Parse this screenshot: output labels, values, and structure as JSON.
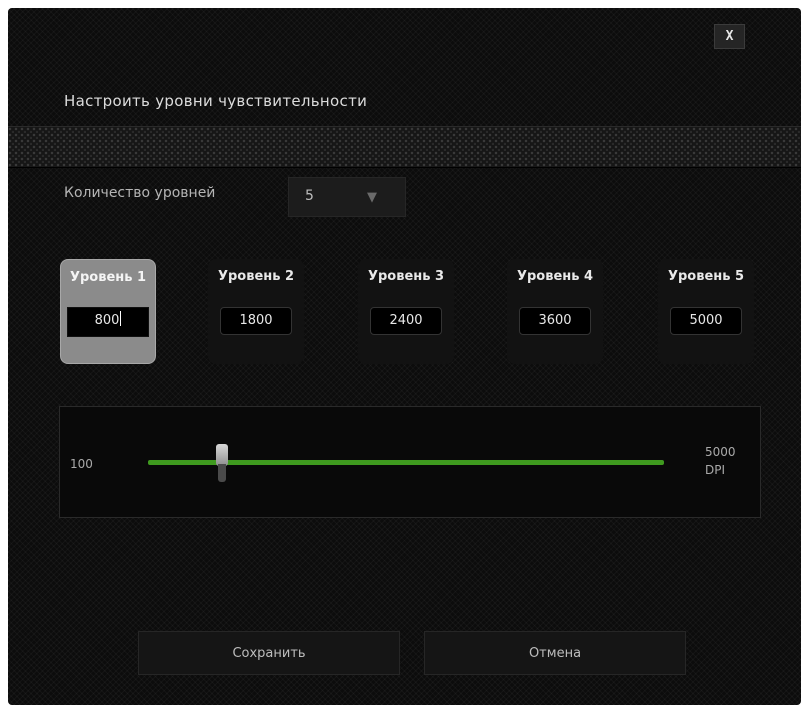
{
  "dialog": {
    "title": "Настроить уровни чувствительности",
    "close_label": "X"
  },
  "levels_count": {
    "label": "Количество уровней",
    "value": "5",
    "arrow_icon": "▼"
  },
  "levels": [
    {
      "label": "Уровень 1",
      "value": "800",
      "active": true
    },
    {
      "label": "Уровень 2",
      "value": "1800",
      "active": false
    },
    {
      "label": "Уровень 3",
      "value": "2400",
      "active": false
    },
    {
      "label": "Уровень 4",
      "value": "3600",
      "active": false
    },
    {
      "label": "Уровень 5",
      "value": "5000",
      "active": false
    }
  ],
  "slider": {
    "min_label": "100",
    "max_label": "5000",
    "unit_label": "DPI",
    "accent_color": "#3f9a1f"
  },
  "buttons": {
    "save_label": "Сохранить",
    "cancel_label": "Отмена"
  }
}
